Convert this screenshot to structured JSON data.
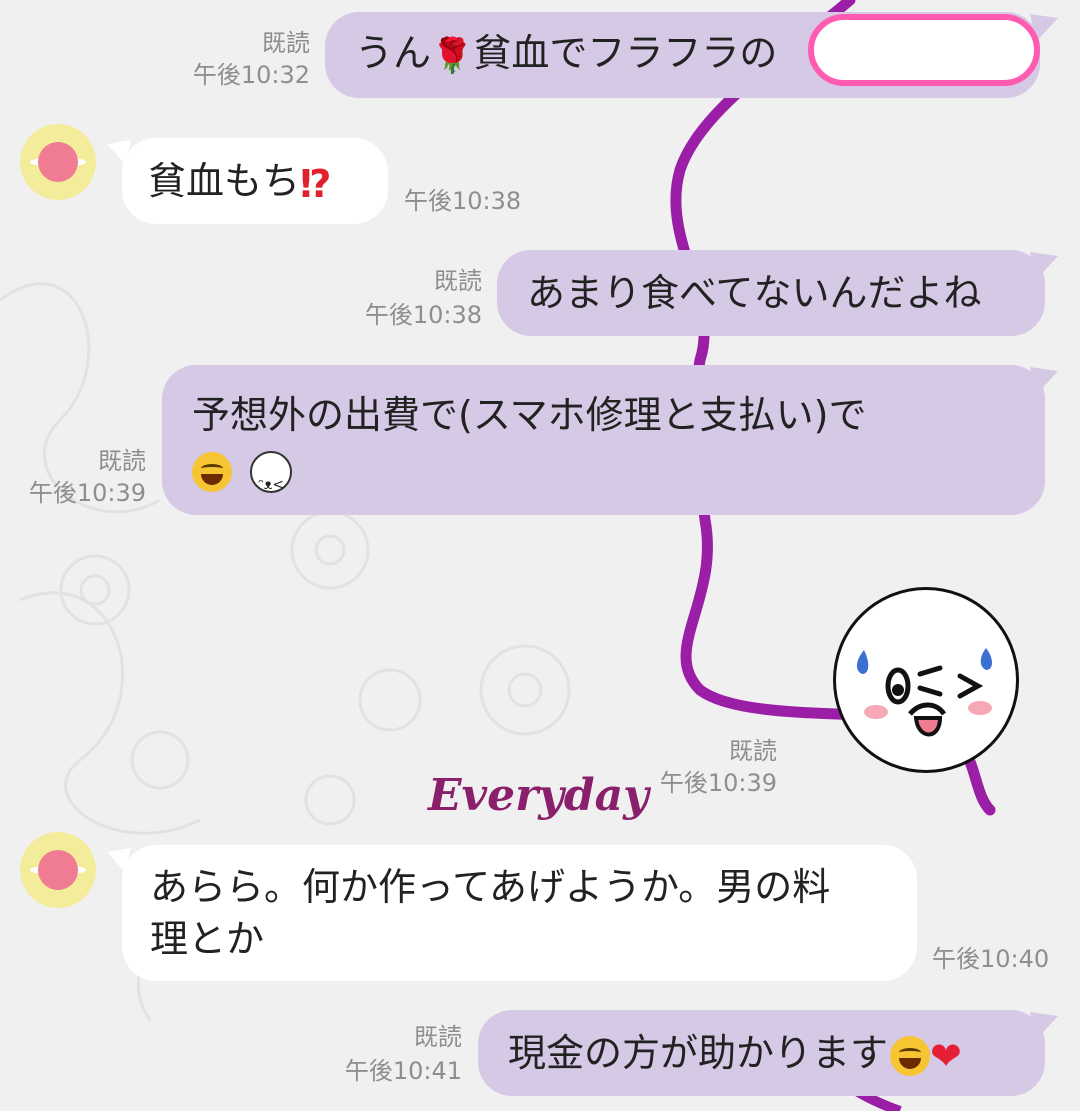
{
  "watermark": "Everyday",
  "messages": [
    {
      "side": "out",
      "text_pre": "うん",
      "text_post": "貧血でフラフラの",
      "read": "既読",
      "time": "午後10:32"
    },
    {
      "side": "in",
      "text_pre": "貧血もち",
      "time": "午後10:38"
    },
    {
      "side": "out",
      "text": "あまり食べてないんだよね",
      "read": "既読",
      "time": "午後10:38"
    },
    {
      "side": "out",
      "line1": "予想外の出費で(スマホ修理と支払い)で",
      "read": "既読",
      "time": "午後10:39"
    },
    {
      "side": "out",
      "sticker": "moon-wink-sticker",
      "read": "既読",
      "time": "午後10:39"
    },
    {
      "side": "in",
      "line1": "あらら。何か作ってあげようか。男の料",
      "line2": "理とか",
      "time": "午後10:40"
    },
    {
      "side": "out",
      "text_pre": "現金の方が助かります",
      "read": "既読",
      "time": "午後10:41"
    }
  ],
  "icons": {
    "rose": "🌹",
    "interrobang": "⁉",
    "heart": "❤"
  },
  "colors": {
    "outgoing_bubble": "#d5c9e6",
    "incoming_bubble": "#ffffff",
    "meta_text": "#8e8e8e",
    "thread": "#9b1fa6"
  }
}
